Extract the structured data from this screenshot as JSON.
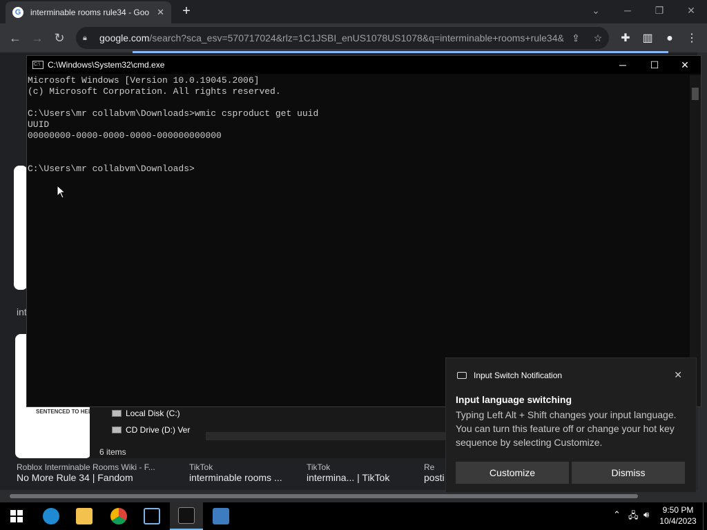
{
  "browser": {
    "tab_title": "interminable rooms rule34 - Goo",
    "tab_close": "✕",
    "new_tab": "+",
    "url_domain": "google.com",
    "url_rest": "/search?sca_esv=570717024&rlz=1C1JSBI_enUS1078US1078&q=interminable+rooms+rule34&...",
    "icons": [
      "back-icon",
      "forward-icon",
      "reload-icon",
      "lock-icon",
      "share-icon",
      "star-icon",
      "extensions-icon",
      "sidepanel-icon",
      "profile-icon",
      "menu-icon"
    ]
  },
  "results": [
    {
      "source": "Roblox Interminable Rooms Wiki - F...",
      "title": "No More Rule 34 | Fandom"
    },
    {
      "source": "TikTok",
      "title": "interminable rooms ..."
    },
    {
      "source": "TikTok",
      "title": "intermina... | TikTok"
    },
    {
      "source": "Re",
      "title": "posti"
    }
  ],
  "side_labels": {
    "a": "int",
    "b": "SENTENCED TO HELL!!!"
  },
  "explorer": {
    "items": [
      "Local Disk (C:)",
      "CD Drive (D:) Ver"
    ],
    "status": "6 items"
  },
  "cmd": {
    "title": "C:\\Windows\\System32\\cmd.exe",
    "lines": "Microsoft Windows [Version 10.0.19045.2006]\n(c) Microsoft Corporation. All rights reserved.\n\nC:\\Users\\mr collabvm\\Downloads>wmic csproduct get uuid\nUUID\n00000000-0000-0000-0000-000000000000\n\n\nC:\\Users\\mr collabvm\\Downloads>"
  },
  "toast": {
    "header": "Input Switch Notification",
    "title": "Input language switching",
    "message": "Typing Left Alt + Shift changes your input language. You can turn this feature off or change your hot key sequence by selecting Customize.",
    "customize": "Customize",
    "dismiss": "Dismiss"
  },
  "clock": {
    "time": "9:50 PM",
    "date": "10/4/2023"
  },
  "colors": {
    "accent": "#0078d4",
    "cmd_bg": "#0c0c0c",
    "chrome_bg": "#202124"
  }
}
